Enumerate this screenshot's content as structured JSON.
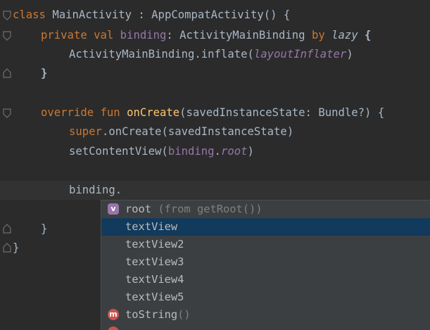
{
  "code": {
    "line1": {
      "kw": "class",
      "name": " MainActivity : AppCompatActivity() {"
    },
    "line2": {
      "kw": "private val",
      "prop": "binding",
      "type": ": ActivityMainBinding",
      "by": "by",
      "lazy": "lazy",
      "brace": " {"
    },
    "line3": {
      "call": "ActivityMainBinding.inflate(",
      "arg": "layoutInflater",
      "close": ")"
    },
    "line4": {
      "text": "}"
    },
    "line6": {
      "kw": "override fun",
      "fn": "onCreate",
      "rest": "(savedInstanceState: Bundle?) {"
    },
    "line7": {
      "kw": "super",
      "rest": ".onCreate(savedInstanceState)"
    },
    "line8": {
      "call": "setContentView(",
      "obj": "binding",
      "dot": ".",
      "prop": "root",
      "close": ")"
    },
    "line10": {
      "text": "binding."
    },
    "line12": {
      "text": "}"
    },
    "line13": {
      "text": "}"
    }
  },
  "completion": {
    "items": [
      {
        "icon": "v",
        "icon_name": "variable-icon",
        "label": "root",
        "hint": " (from getRoot())"
      },
      {
        "icon": "",
        "label": "textView",
        "selected": true
      },
      {
        "icon": "",
        "label": "textView2"
      },
      {
        "icon": "",
        "label": "textView3"
      },
      {
        "icon": "",
        "label": "textView4"
      },
      {
        "icon": "",
        "label": "textView5"
      },
      {
        "icon": "m",
        "icon_name": "method-icon",
        "label": "toString",
        "hint": "()"
      },
      {
        "icon": "",
        "icon_name": "method-icon",
        "label": ""
      }
    ]
  },
  "colors": {
    "background": "#2b2b2b",
    "keyword": "#cc7832",
    "function": "#ffc66d",
    "property": "#9876aa",
    "popup": "#3c3f41",
    "selection": "#113a5c"
  }
}
